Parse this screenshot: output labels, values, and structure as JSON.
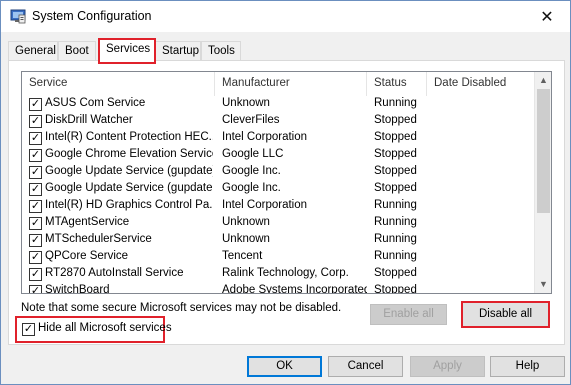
{
  "window": {
    "title": "System Configuration",
    "close_glyph": "✕"
  },
  "tabs": [
    {
      "label": "General"
    },
    {
      "label": "Boot"
    },
    {
      "label": "Services"
    },
    {
      "label": "Startup"
    },
    {
      "label": "Tools"
    }
  ],
  "active_tab": "Services",
  "table": {
    "columns": [
      "Service",
      "Manufacturer",
      "Status",
      "Date Disabled"
    ],
    "rows": [
      {
        "checked": true,
        "service": "ASUS Com Service",
        "manufacturer": "Unknown",
        "status": "Running",
        "date": ""
      },
      {
        "checked": true,
        "service": "DiskDrill Watcher",
        "manufacturer": "CleverFiles",
        "status": "Stopped",
        "date": ""
      },
      {
        "checked": true,
        "service": "Intel(R) Content Protection HEC...",
        "manufacturer": "Intel Corporation",
        "status": "Stopped",
        "date": ""
      },
      {
        "checked": true,
        "service": "Google Chrome Elevation Service",
        "manufacturer": "Google LLC",
        "status": "Stopped",
        "date": ""
      },
      {
        "checked": true,
        "service": "Google Update Service (gupdate)",
        "manufacturer": "Google Inc.",
        "status": "Stopped",
        "date": ""
      },
      {
        "checked": true,
        "service": "Google Update Service (gupdatem)",
        "manufacturer": "Google Inc.",
        "status": "Stopped",
        "date": ""
      },
      {
        "checked": true,
        "service": "Intel(R) HD Graphics Control Pa...",
        "manufacturer": "Intel Corporation",
        "status": "Running",
        "date": ""
      },
      {
        "checked": true,
        "service": "MTAgentService",
        "manufacturer": "Unknown",
        "status": "Running",
        "date": ""
      },
      {
        "checked": true,
        "service": "MTSchedulerService",
        "manufacturer": "Unknown",
        "status": "Running",
        "date": ""
      },
      {
        "checked": true,
        "service": "QPCore Service",
        "manufacturer": "Tencent",
        "status": "Running",
        "date": ""
      },
      {
        "checked": true,
        "service": "RT2870 AutoInstall Service",
        "manufacturer": "Ralink Technology, Corp.",
        "status": "Stopped",
        "date": ""
      },
      {
        "checked": true,
        "service": "SwitchBoard",
        "manufacturer": "Adobe Systems Incorporated",
        "status": "Stopped",
        "date": ""
      }
    ],
    "check_glyph": "✓"
  },
  "note": "Note that some secure Microsoft services may not be disabled.",
  "buttons": {
    "enable_all": "Enable all",
    "disable_all": "Disable all",
    "ok": "OK",
    "cancel": "Cancel",
    "apply": "Apply",
    "help": "Help"
  },
  "hide_ms": {
    "label": "Hide all Microsoft services",
    "checked": true
  },
  "colors": {
    "highlight": "#e0212b",
    "accent": "#0078d7"
  }
}
